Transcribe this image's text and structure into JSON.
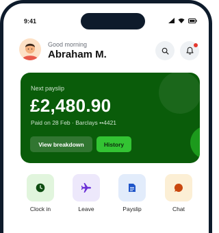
{
  "status_bar": {
    "time": "9:41"
  },
  "header": {
    "greeting": "Good morning",
    "user_name": "Abraham M."
  },
  "payslip": {
    "label": "Next payslip",
    "amount": "£2,480.90",
    "paid_info": "Paid on 28 Feb · Barclays ••4421",
    "breakdown_label": "View breakdown",
    "history_label": "History"
  },
  "quick_actions": [
    {
      "label": "Clock in",
      "icon": "clock-icon"
    },
    {
      "label": "Leave",
      "icon": "plane-icon"
    },
    {
      "label": "Payslip",
      "icon": "document-icon"
    },
    {
      "label": "Chat",
      "icon": "chat-bubble-icon"
    }
  ],
  "colors": {
    "card_bg": "#0a5c0a",
    "history_button": "#33c433",
    "notification_dot": "#e5392f"
  }
}
